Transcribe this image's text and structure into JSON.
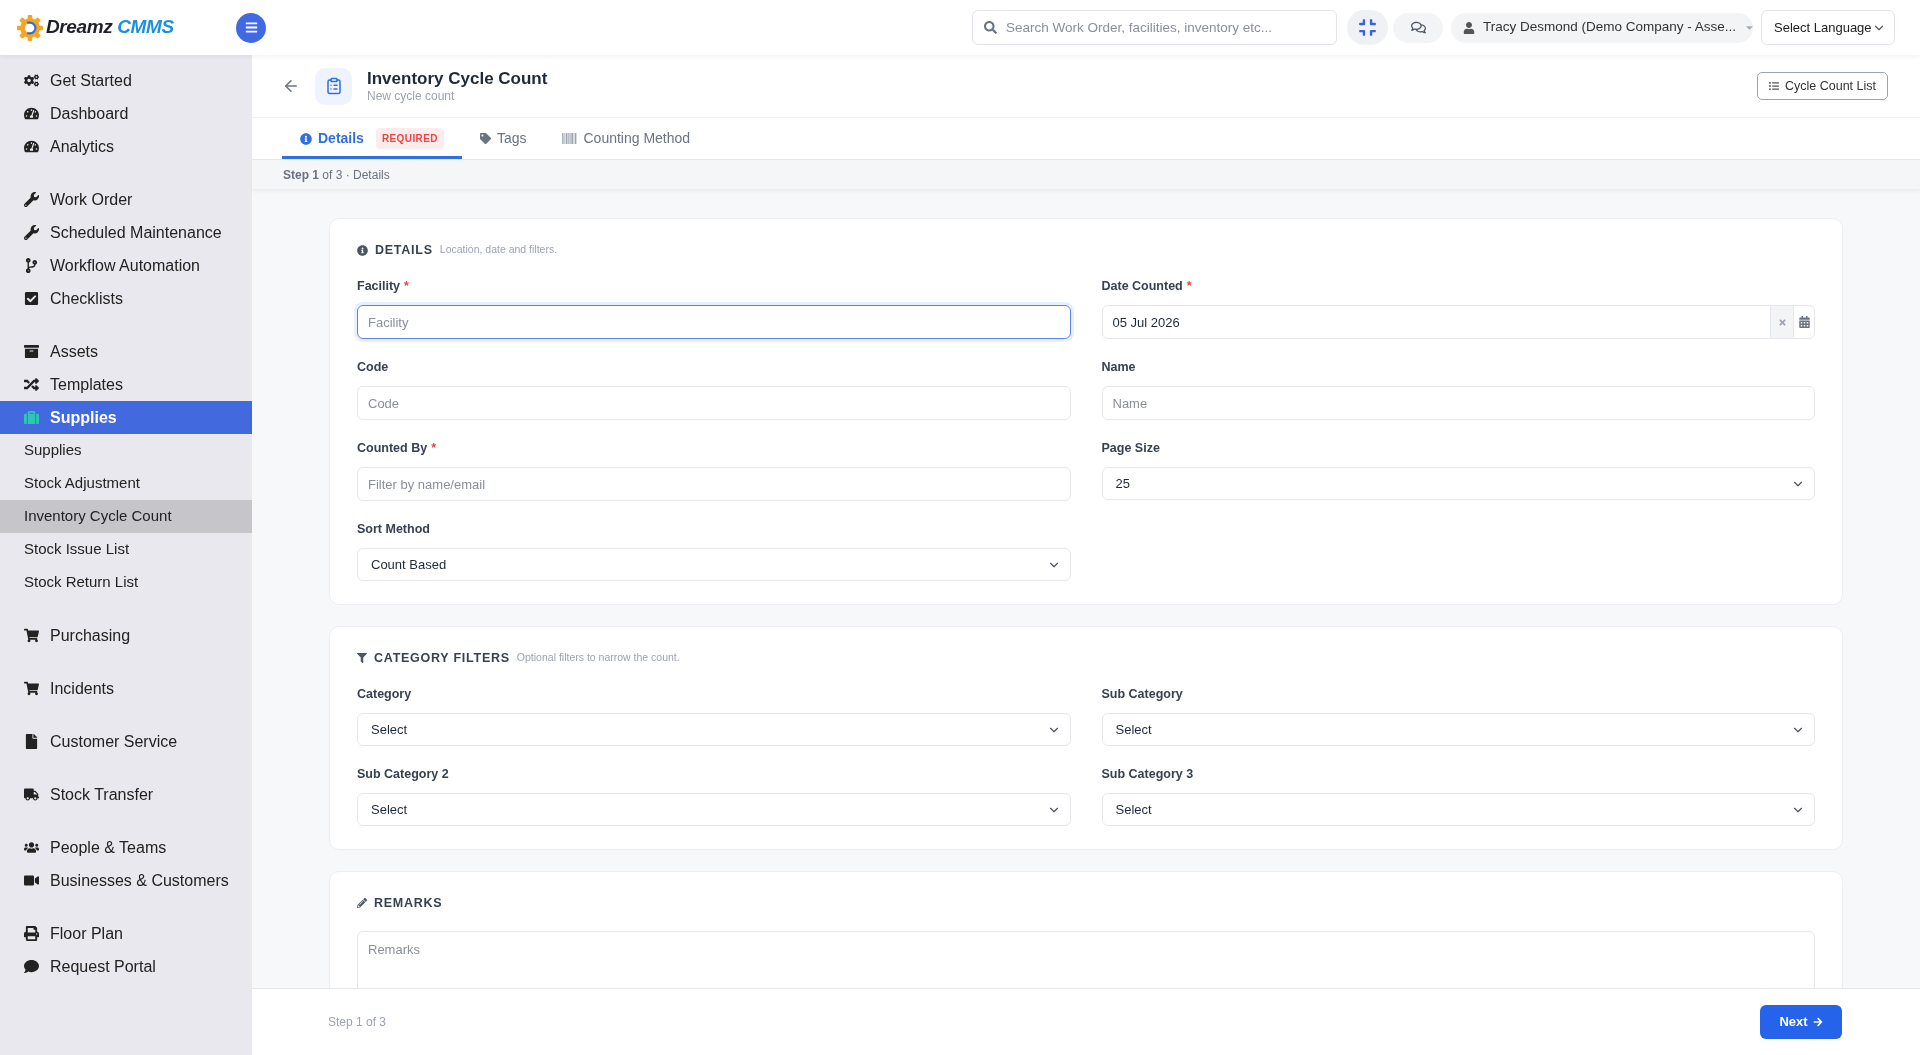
{
  "topbar": {
    "logo": {
      "word_1": "Dreamz",
      "word_2": "CMMS"
    },
    "search": {
      "placeholder": "Search Work Order, facilities, inventory etc..."
    },
    "user_menu": {
      "label": "Tracy Desmond (Demo Company - Asse..."
    },
    "language_select": {
      "value": "Select Language"
    }
  },
  "sidebar": {
    "groups": [
      {
        "items": [
          {
            "label": "Get Started",
            "selected": false
          },
          {
            "label": "Dashboard",
            "selected": false
          },
          {
            "label": "Analytics",
            "selected": false
          }
        ]
      },
      {
        "items": [
          {
            "label": "Work Order",
            "selected": false
          },
          {
            "label": "Scheduled Maintenance",
            "selected": false
          },
          {
            "label": "Workflow Automation",
            "selected": false
          },
          {
            "label": "Checklists",
            "selected": false
          }
        ]
      },
      {
        "items": [
          {
            "label": "Assets",
            "selected": false
          },
          {
            "label": "Templates",
            "selected": false
          },
          {
            "label": "Supplies",
            "selected": true,
            "children": [
              {
                "label": "Supplies",
                "selected": false
              },
              {
                "label": "Stock Adjustment",
                "selected": false
              },
              {
                "label": "Inventory Cycle Count",
                "selected": true
              },
              {
                "label": "Stock Issue List",
                "selected": false
              },
              {
                "label": "Stock Return List",
                "selected": false
              }
            ]
          }
        ]
      },
      {
        "items": [
          {
            "label": "Purchasing",
            "selected": false
          }
        ]
      },
      {
        "items": [
          {
            "label": "Incidents",
            "selected": false
          }
        ]
      },
      {
        "items": [
          {
            "label": "Customer Service",
            "selected": false
          }
        ]
      },
      {
        "items": [
          {
            "label": "Stock Transfer",
            "selected": false
          }
        ]
      },
      {
        "items": [
          {
            "label": "People & Teams",
            "selected": false
          },
          {
            "label": "Businesses & Customers",
            "selected": false
          }
        ]
      },
      {
        "items": [
          {
            "label": "Floor Plan",
            "selected": false
          },
          {
            "label": "Request Portal",
            "selected": false
          }
        ]
      }
    ]
  },
  "page_header": {
    "title": "Inventory Cycle Count",
    "subtitle": "New cycle count",
    "list_button": "Cycle Count List"
  },
  "tabs": [
    {
      "label": "Details",
      "badge": "REQUIRED",
      "selected": true
    },
    {
      "label": "Tags",
      "selected": false
    },
    {
      "label": "Counting Method",
      "selected": false
    }
  ],
  "step_indicator": "**Step 1** of 3 · Details",
  "sections": [
    {
      "title": "DETAILS",
      "hint": "Location, date and filters.",
      "fields": [
        {
          "kind": "text",
          "label": "Facility",
          "required_mark": "*",
          "placeholder": "Facility",
          "focused": true
        },
        {
          "kind": "date",
          "label": "Date Counted",
          "required_mark": "*",
          "value": "05 Jul 2026",
          "focused": false
        },
        {
          "kind": "text",
          "label": "Code",
          "placeholder": "Code",
          "focused": false
        },
        {
          "kind": "text",
          "label": "Name",
          "placeholder": "Name",
          "focused": false
        },
        {
          "kind": "text",
          "label": "Counted By",
          "required_mark": "*",
          "placeholder": "Filter by name/email",
          "focused": false
        },
        {
          "kind": "select",
          "label": "Page Size",
          "value": "25",
          "focused": false
        },
        {
          "kind": "select",
          "label": "Sort Method",
          "value": "Count Based",
          "focused": false
        }
      ]
    },
    {
      "title": "CATEGORY FILTERS",
      "hint": "Optional filters to narrow the count.",
      "fields": [
        {
          "kind": "select",
          "label": "Category",
          "value": "Select",
          "focused": false
        },
        {
          "kind": "select",
          "label": "Sub Category",
          "value": "Select",
          "focused": false
        },
        {
          "kind": "select",
          "label": "Sub Category 2",
          "value": "Select",
          "focused": false
        },
        {
          "kind": "select",
          "label": "Sub Category 3",
          "value": "Select",
          "focused": false
        }
      ]
    },
    {
      "title": "REMARKS",
      "fields": [
        {
          "kind": "textarea",
          "placeholder": "Remarks",
          "focused": false
        }
      ]
    }
  ],
  "footer": {
    "step_text": "Step 1 of 3",
    "next_button": "Next"
  }
}
